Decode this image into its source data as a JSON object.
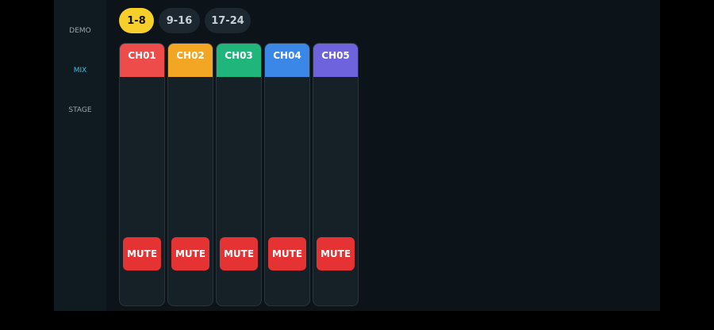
{
  "tabs": [
    "1-8",
    "9-16",
    "17-24"
  ],
  "side": [
    "DEMO",
    "MIX",
    "STAGE"
  ],
  "channels": [
    {
      "name": "CH01",
      "color": "#ee4b4b"
    },
    {
      "name": "CH02",
      "color": "#f3a623"
    },
    {
      "name": "CH03",
      "color": "#20b57a"
    },
    {
      "name": "CH04",
      "color": "#3a87e8"
    },
    {
      "name": "CH05",
      "color": "#6f63dd"
    }
  ],
  "mute": "MUTE"
}
